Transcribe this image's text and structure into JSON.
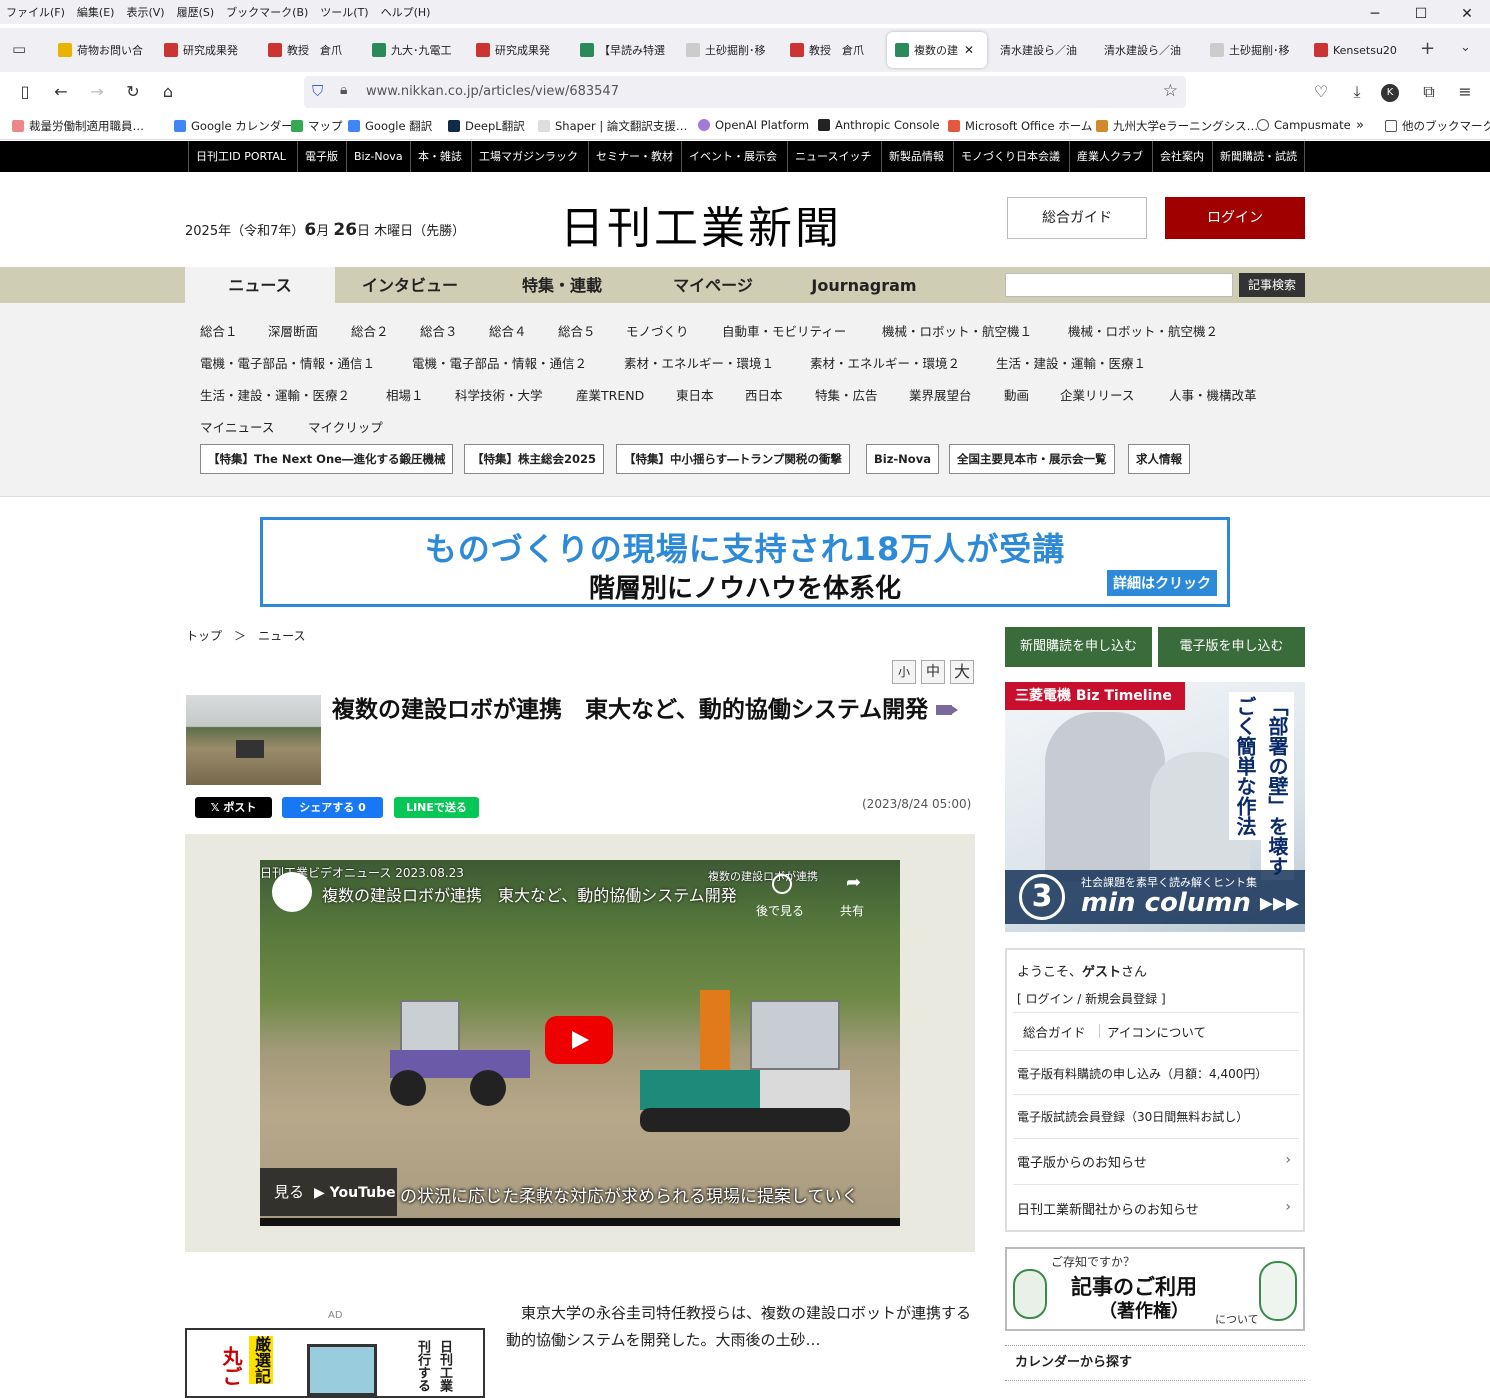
{
  "menubar": [
    "ファイル(F)",
    "編集(E)",
    "表示(V)",
    "履歴(S)",
    "ブックマーク(B)",
    "ツール(T)",
    "ヘルプ(H)"
  ],
  "window_controls": [
    "─",
    "☐",
    "✕"
  ],
  "tabs": [
    "荷物お問い合",
    "研究成果発",
    "教授　倉爪",
    "九大･九電工",
    "研究成果発",
    "【早読み特選",
    "土砂掘削･移",
    "教授　倉爪",
    "複数の建",
    "清水建設ら／油",
    "清水建設ら／油",
    "土砂掘削･移",
    "Kensetsu20"
  ],
  "url": "www.nikkan.co.jp/articles/view/683547",
  "bookmarks": [
    "裁量労働制適用職員…",
    "Google カレンダー",
    "マップ",
    "Google 翻訳",
    "DeepL翻訳",
    "Shaper | 論文翻訳支援…",
    "OpenAI Platform",
    "Anthropic Console",
    "Microsoft Office ホーム",
    "九州大学eラーニングシス…",
    "Campusmate",
    "他のブックマーク"
  ],
  "topnav": [
    "日刊工ID PORTAL",
    "電子版",
    "Biz-Nova",
    "本・雑誌",
    "工場マガジンラック",
    "セミナー・教材",
    "イベント・展示会",
    "ニュースイッチ",
    "新製品情報",
    "モノづくり日本会議",
    "産業人クラブ",
    "会社案内",
    "新聞購読・試読"
  ],
  "header": {
    "date_a": "2025年（令和7年）",
    "month": "6",
    "date_b": "月",
    "day": "26",
    "date_c": "日 木曜日（先勝）",
    "logo": "日刊工業新聞",
    "guide": "総合ガイド",
    "login": "ログイン"
  },
  "mainnav": [
    "ニュース",
    "インタビュー",
    "特集・連載",
    "マイページ",
    "Journagram"
  ],
  "search_button": "記事検索",
  "categories": [
    [
      "総合１",
      "深層断面",
      "総合２",
      "総合３",
      "総合４",
      "総合５",
      "モノづくり",
      "自動車・モビリティー",
      "機械・ロボット・航空機１",
      "機械・ロボット・航空機２"
    ],
    [
      "電機・電子部品・情報・通信１",
      "電機・電子部品・情報・通信２",
      "素材・エネルギー・環境１",
      "素材・エネルギー・環境２",
      "生活・建設・運輸・医療１"
    ],
    [
      "生活・建設・運輸・医療２",
      "相場１",
      "科学技術・大学",
      "産業TREND",
      "東日本",
      "西日本",
      "特集・広告",
      "業界展望台",
      "動画",
      "企業リリース",
      "人事・機構改革"
    ],
    [
      "マイニュース",
      "マイクリップ"
    ]
  ],
  "feature_buttons": [
    "【特集】The Next One―進化する鍛圧機械",
    "【特集】株主総会2025",
    "【特集】中小揺らす―トランプ関税の衝撃",
    "Biz-Nova",
    "全国主要見本市・展示会一覧",
    "求人情報"
  ],
  "banner_ad": {
    "line1": "ものづくりの現場に支持され18万人が受講",
    "line2": "階層別にノウハウを体系化",
    "button": "詳細はクリック"
  },
  "breadcrumb": [
    "トップ",
    "＞",
    "ニュース"
  ],
  "font_sizes": [
    "小",
    "中",
    "大"
  ],
  "article": {
    "title": "複数の建設ロボが連携　東大など、動的協働システム開発",
    "date": "(2023/8/24 05:00)",
    "lead": "東京大学の永谷圭司特任教授らは、複数の建設ロボットが連携する動的協働システムを開発した。大雨後の土砂…"
  },
  "share": [
    "𝕏 ポスト",
    "シェアする 0",
    "LINEで送る"
  ],
  "video": {
    "header": "日刊工業ビデオニュース 2023.08.23",
    "title": "複数の建設ロボが連携　東大など、動的協働システム開発",
    "overlay": "複数の建設ロボが連携",
    "later": "後で見る",
    "share": "共有",
    "watch": "見る",
    "youtube": "▶ YouTube",
    "caption": "の状況に応じた柔軟な対応が求められる現場に提案していく"
  },
  "ad_label": "AD",
  "left_ad": {
    "v1": "丸ご",
    "v2": "厳選記",
    "v3": "日刊工業",
    "v4": "刊行する"
  },
  "sidebar": {
    "btn_paper": "新聞購読を申し込む",
    "btn_digital": "電子版を申し込む",
    "ad": {
      "tag": "三菱電機 Biz Timeline",
      "v1": "「部署の壁」を壊す",
      "v2": "ごく簡単な作法",
      "b1": "社会課題を素早く読み解くヒント集",
      "b2": "min column ▸▸▸",
      "b3": "3"
    },
    "guest": {
      "welcome_a": "ようこそ、",
      "welcome_name": "ゲスト",
      "welcome_b": "さん",
      "login_link": "[ ログイン / 新規会員登録 ]",
      "guide": "総合ガイド",
      "icons": "アイコンについて",
      "item1": "電子版有料購読の申し込み（月額：4,400円）",
      "item2": "電子版試読会員登録（30日間無料お試し）",
      "item3": "電子版からのお知らせ",
      "item4": "日刊工業新聞社からのお知らせ"
    },
    "copyright_ad": {
      "t1": "ご存知ですか？",
      "t2": "記事のご利用",
      "t3": "（著作権）",
      "t4": "について"
    },
    "calendar": "カレンダーから探す"
  },
  "colors": {
    "accent_red": "#a00000",
    "nav_bg": "#cfcdb4",
    "green": "#3a6b3a",
    "ad_blue": "#2d8ad8"
  }
}
